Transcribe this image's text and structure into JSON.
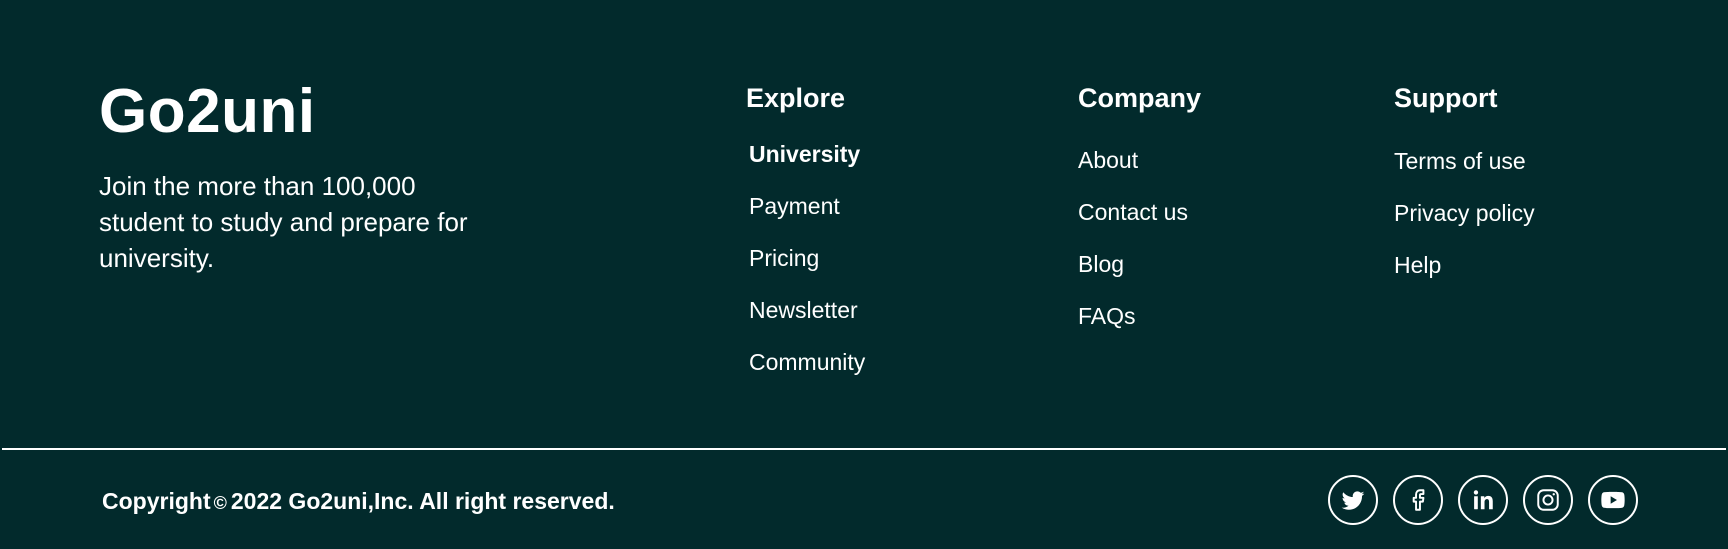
{
  "brand": {
    "name": "Go2uni",
    "tagline": "Join the more than 100,000 student to study and prepare for university."
  },
  "columns": [
    {
      "title": "Explore",
      "links": [
        "University",
        "Payment",
        "Pricing",
        "Newsletter",
        "Community"
      ]
    },
    {
      "title": "Company",
      "links": [
        "About",
        "Contact us",
        "Blog",
        "FAQs"
      ]
    },
    {
      "title": "Support",
      "links": [
        "Terms of use",
        "Privacy policy",
        "Help"
      ]
    }
  ],
  "copyright": {
    "prefix": "Copyright",
    "symbol": "©",
    "text": "2022 Go2uni,Inc. All right reserved."
  },
  "social": [
    {
      "icon": "twitter-icon"
    },
    {
      "icon": "facebook-icon"
    },
    {
      "icon": "linkedin-icon"
    },
    {
      "icon": "instagram-icon"
    },
    {
      "icon": "youtube-icon"
    }
  ],
  "colors": {
    "background": "#022a2c",
    "foreground": "#ffffff"
  }
}
